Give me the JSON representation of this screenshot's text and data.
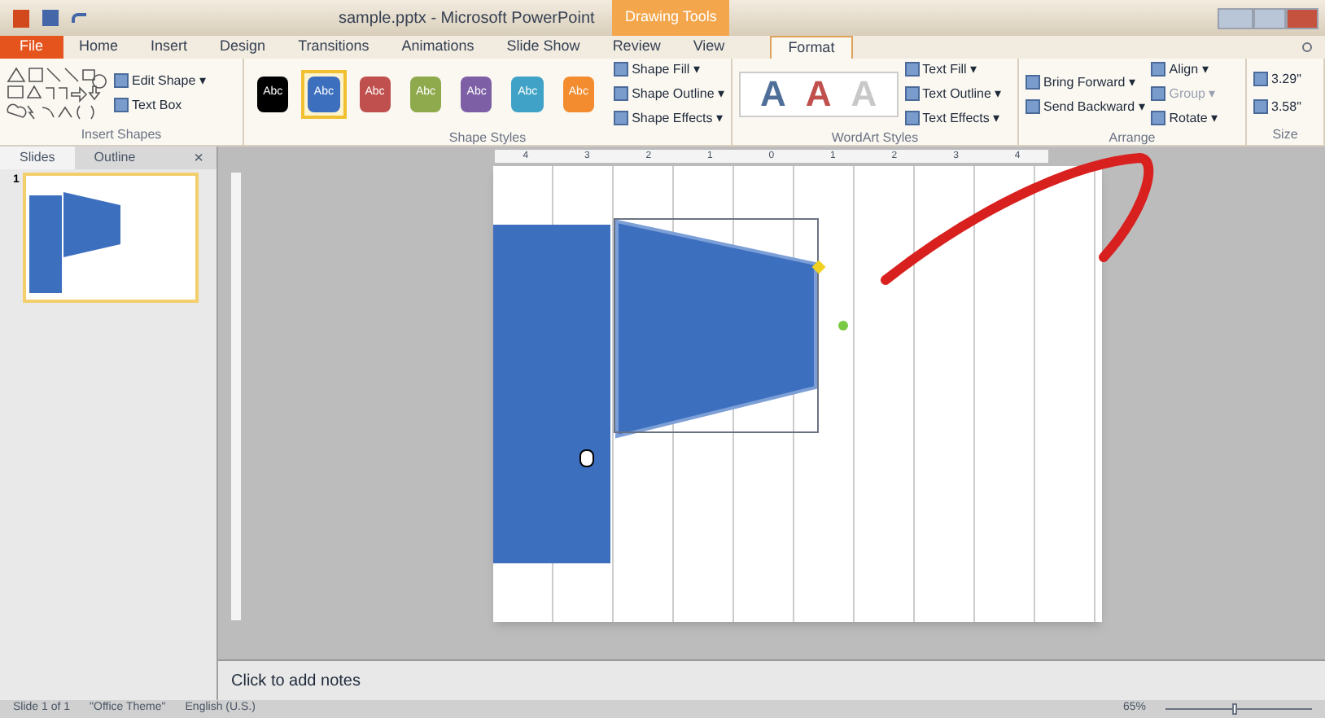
{
  "window": {
    "title": "sample.pptx - Microsoft PowerPoint",
    "context_tab": "Drawing Tools"
  },
  "tabs": [
    {
      "label": "File",
      "kind": "file",
      "selected": false
    },
    {
      "label": "Home",
      "kind": "tab",
      "selected": false
    },
    {
      "label": "Insert",
      "kind": "tab",
      "selected": false
    },
    {
      "label": "Design",
      "kind": "tab",
      "selected": false
    },
    {
      "label": "Transitions",
      "kind": "tab",
      "selected": false
    },
    {
      "label": "Animations",
      "kind": "tab",
      "selected": false
    },
    {
      "label": "Slide Show",
      "kind": "tab",
      "selected": false
    },
    {
      "label": "Review",
      "kind": "tab",
      "selected": false
    },
    {
      "label": "View",
      "kind": "tab",
      "selected": false
    },
    {
      "label": "Format",
      "kind": "tab",
      "selected": true
    }
  ],
  "ribbon": {
    "insert_shapes": {
      "buttons": [
        "Edit Shape ▾",
        "Text Box"
      ],
      "label": "Insert Shapes"
    },
    "shape_styles": {
      "swatches": [
        {
          "label": "Abc",
          "color": "#000000",
          "selected": false
        },
        {
          "label": "Abc",
          "color": "#3d6fbf",
          "selected": true
        },
        {
          "label": "Abc",
          "color": "#c0504d",
          "selected": false
        },
        {
          "label": "Abc",
          "color": "#8faa4c",
          "selected": false
        },
        {
          "label": "Abc",
          "color": "#7d5fa5",
          "selected": false
        },
        {
          "label": "Abc",
          "color": "#3fa2c6",
          "selected": false
        },
        {
          "label": "Abc",
          "color": "#f28c2f",
          "selected": false
        }
      ],
      "buttons": [
        "Shape Fill ▾",
        "Shape Outline ▾",
        "Shape Effects ▾"
      ],
      "label": "Shape Styles"
    },
    "wordart": {
      "letters": [
        {
          "label": "A",
          "color": "#4f6f9a"
        },
        {
          "label": "A",
          "color": "#c0504d"
        },
        {
          "label": "A",
          "color": "#c8c8c8"
        }
      ],
      "buttons": [
        "Text Fill ▾",
        "Text Outline ▾",
        "Text Effects ▾"
      ],
      "label": "WordArt Styles"
    },
    "arrange": {
      "buttons": [
        "Bring Forward ▾",
        "Send Backward ▾",
        "Align ▾",
        "Group ▾",
        "Rotate ▾"
      ],
      "label": "Arrange"
    },
    "size": {
      "height": "3.29\"",
      "width": "3.58\"",
      "label": "Size"
    }
  },
  "panel": {
    "tabs": [
      {
        "label": "Slides",
        "selected": true
      },
      {
        "label": "Outline",
        "selected": false
      }
    ],
    "close": "×",
    "thumbnails": [
      {
        "number": "1",
        "selected": true
      }
    ]
  },
  "ruler": [
    "4",
    "3",
    "2",
    "1",
    "0",
    "1",
    "2",
    "3",
    "4"
  ],
  "notes": {
    "placeholder": "Click to add notes"
  },
  "status_bar": {
    "slide": "Slide 1 of 1",
    "theme": "\"Office Theme\"",
    "language": "English (U.S.)",
    "zoom": "65%",
    "zoom_slider": {
      "level": 0.45
    }
  }
}
